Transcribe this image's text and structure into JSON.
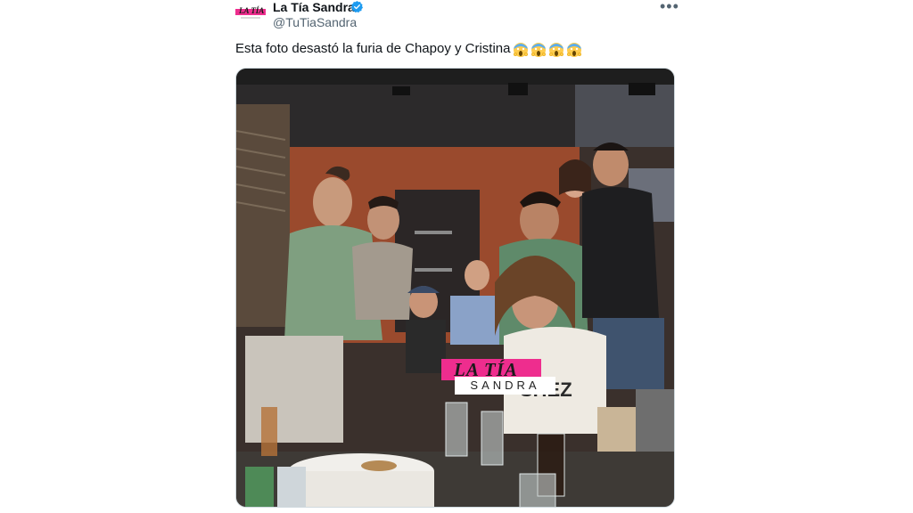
{
  "tweet": {
    "author_name": "La Tía Sandra",
    "handle": "@TuTiaSandra",
    "text": "Esta foto desastó la furia de Chapoy y Cristina",
    "emoji": [
      "face-screaming-in-fear",
      "face-screaming-in-fear",
      "face-screaming-in-fear",
      "face-screaming-in-fear"
    ],
    "more_icon": "more-options-icon",
    "verified_icon": "verified-badge-icon"
  },
  "avatar": {
    "logo_text": "LA TÍA"
  },
  "photo": {
    "watermark_top": "LA TÍA",
    "watermark_bottom": "SANDRA",
    "shirt_text": "SHEZ"
  },
  "colors": {
    "brand_pink": "#ee2d8e",
    "verified_blue": "#1d9bf0",
    "muted": "#536471"
  }
}
